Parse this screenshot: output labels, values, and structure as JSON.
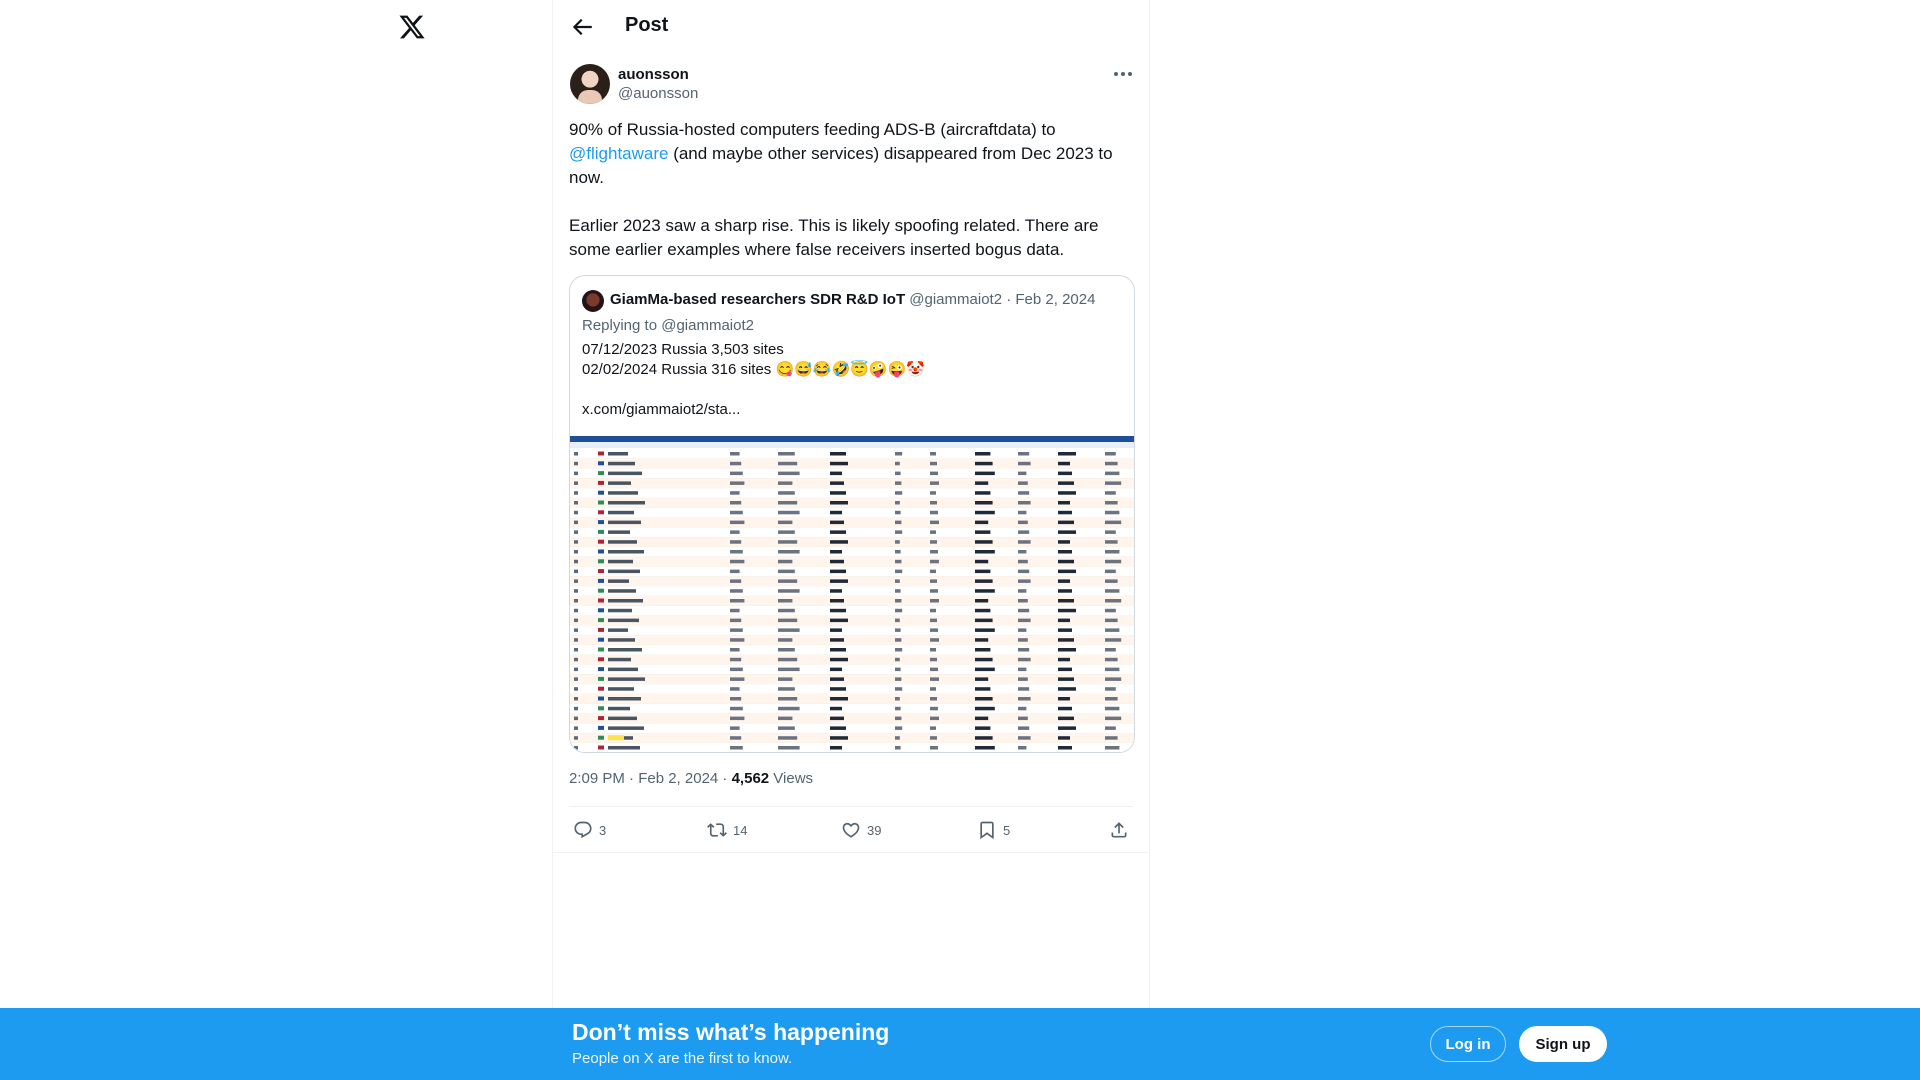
{
  "header": {
    "title": "Post"
  },
  "author": {
    "name": "auonsson",
    "handle": "@auonsson"
  },
  "tweet": {
    "line1": "90% of Russia-hosted computers feeding ADS-B (aircraftdata) to ",
    "mention": "@flightaware",
    "line2": " (and maybe other services) disappeared from Dec 2023 to now.\n\nEarlier 2023 saw a sharp rise. This is likely spoofing related. There are some earlier examples where false receivers inserted bogus data."
  },
  "quote": {
    "name": "GiamMa-based researchers SDR R&D IoT",
    "handle": "@giammaiot2",
    "date": "Feb 2, 2024",
    "replying": "Replying to @giammaiot2",
    "text": "07/12/2023 Russia 3,503 sites\n02/02/2024 Russia 316 sites 😋😅😂🤣😇🤪😜🤡\n\nx.com/giammaiot2/sta..."
  },
  "meta": {
    "time": "2:09 PM · Feb 2, 2024 · ",
    "views": "4,562",
    "views_label": " Views"
  },
  "actions": {
    "replies": "3",
    "reposts": "14",
    "likes": "39",
    "bookmarks": "5"
  },
  "banner": {
    "title": "Don’t miss what’s happening",
    "subtitle": "People on X are the first to know.",
    "login": "Log in",
    "signup": "Sign up"
  },
  "colors": {
    "brand": "#1d9bf0",
    "text": "#0f1419",
    "secondary": "#536471"
  }
}
